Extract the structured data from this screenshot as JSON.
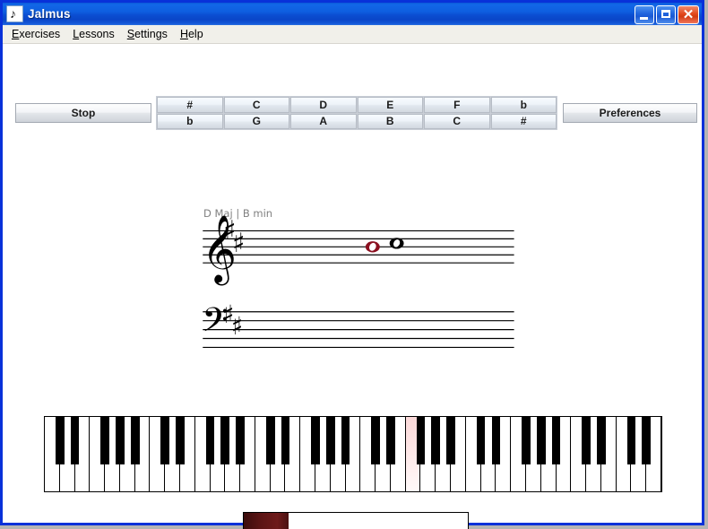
{
  "window": {
    "title": "Jalmus",
    "icon": "music-note-icon",
    "buttons": {
      "minimize": "minimize-icon",
      "maximize": "maximize-icon",
      "close": "close-icon",
      "close_glyph": "✕"
    }
  },
  "menubar": {
    "items": [
      {
        "label": "Exercises",
        "mnemonic": "E"
      },
      {
        "label": "Lessons",
        "mnemonic": "L"
      },
      {
        "label": "Settings",
        "mnemonic": "S"
      },
      {
        "label": "Help",
        "mnemonic": "H"
      }
    ]
  },
  "toolbar": {
    "stop_label": "Stop",
    "preferences_label": "Preferences",
    "note_grid": {
      "row_top": [
        "#",
        "C",
        "D",
        "E",
        "F",
        "b"
      ],
      "row_bottom": [
        "b",
        "G",
        "A",
        "B",
        "C",
        "#"
      ]
    }
  },
  "score": {
    "key_label": "D Maj | B min",
    "treble": {
      "clef": "treble-clef",
      "key_signature": [
        "#",
        "#"
      ],
      "notes": [
        {
          "name": "note-red",
          "color": "#8b1020",
          "duration": "whole",
          "position": "middle-line"
        },
        {
          "name": "note-black",
          "color": "#000000",
          "duration": "whole",
          "position": "space-above-middle"
        }
      ]
    },
    "bass": {
      "clef": "bass-clef",
      "key_signature": [
        "#",
        "#"
      ],
      "notes": []
    }
  },
  "keyboard": {
    "white_key_count": 41,
    "highlighted_white_index": 24,
    "highlight_color": "#fbd9d9"
  },
  "progress": {
    "percent": 20,
    "fill_color": "#5a1414"
  }
}
